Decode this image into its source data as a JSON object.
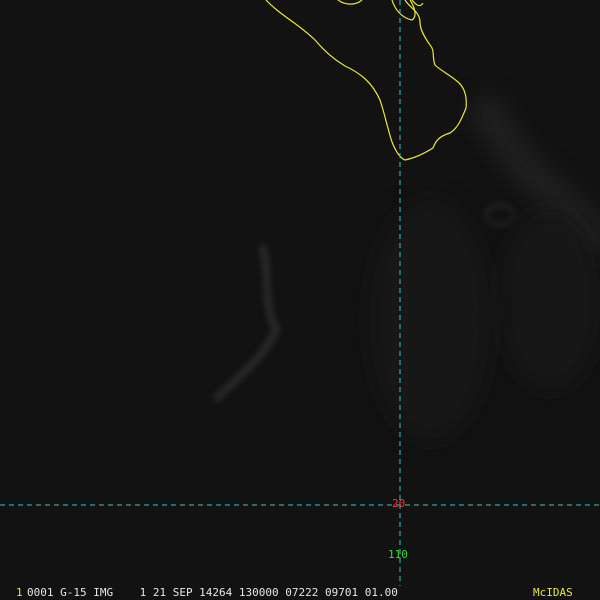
{
  "colors": {
    "background": "#111111",
    "coastline": "#e8e83a",
    "gridline": "#36c7c7",
    "lat_label": "#ff3030",
    "lon_label": "#30e030",
    "status_text": "#e6e6e6",
    "status_frame": "#e8e83a",
    "status_brand": "#e8e83a"
  },
  "map": {
    "lat_label": "20",
    "lon_label": "110"
  },
  "status_bar": {
    "frame_number": "1",
    "text": "0001 G-15 IMG    1 21 SEP 14264 130000 07222 09701 01.00",
    "brand": "McIDAS"
  }
}
